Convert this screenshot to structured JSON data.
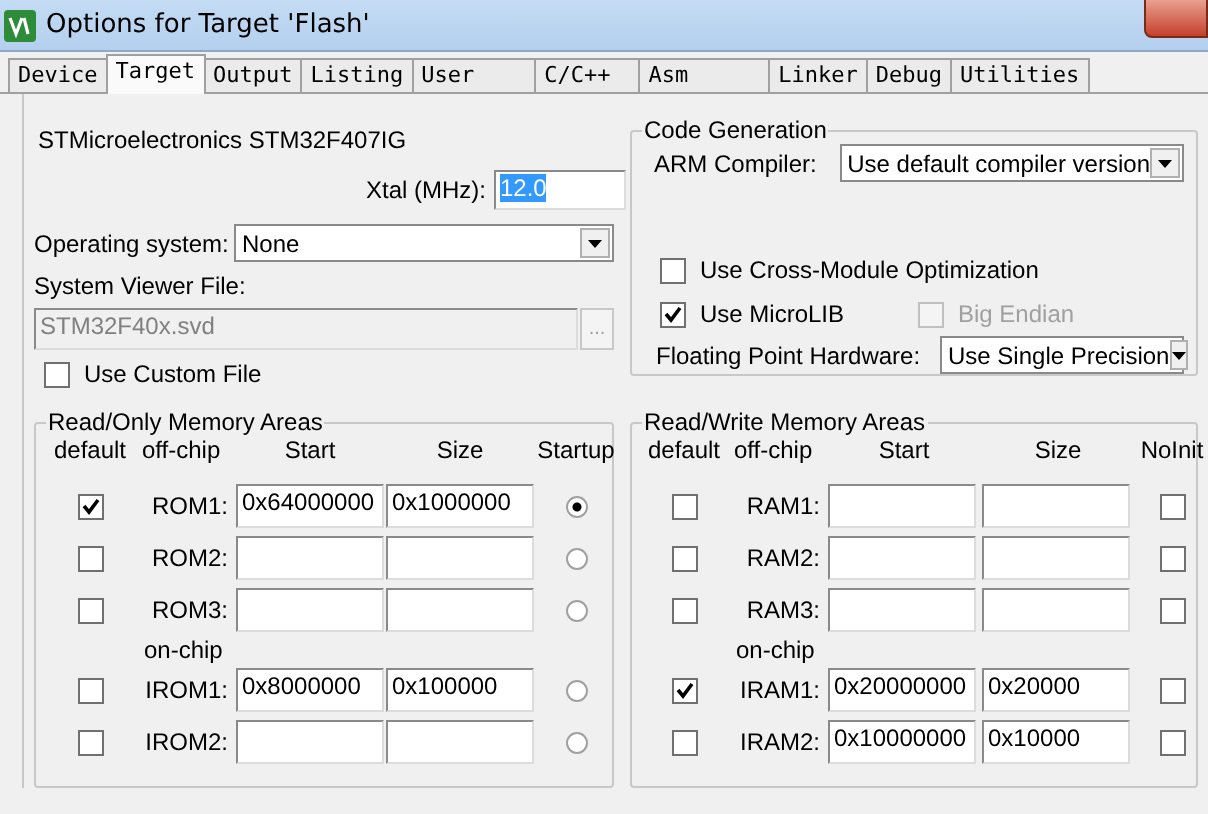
{
  "window": {
    "title": "Options for Target 'Flash'"
  },
  "tabs": [
    {
      "label": "Device",
      "selected": false
    },
    {
      "label": "Target",
      "selected": true
    },
    {
      "label": "Output",
      "selected": false
    },
    {
      "label": "Listing",
      "selected": false
    },
    {
      "label": "User",
      "selected": false
    },
    {
      "label": "C/C++",
      "selected": false
    },
    {
      "label": "Asm",
      "selected": false
    },
    {
      "label": "Linker",
      "selected": false
    },
    {
      "label": "Debug",
      "selected": false
    },
    {
      "label": "Utilities",
      "selected": false
    }
  ],
  "target": {
    "device": "STMicroelectronics STM32F407IG",
    "xtal": {
      "label": "Xtal (MHz):",
      "value": "12.0",
      "text_selected": true
    },
    "os": {
      "label": "Operating system:",
      "value": "None"
    },
    "svf": {
      "label": "System Viewer File:",
      "value": "STM32F40x.svd",
      "disabled": true,
      "browse": "..."
    },
    "custom_file": {
      "label": "Use Custom File",
      "checked": false
    }
  },
  "code_generation": {
    "title": "Code Generation",
    "compiler": {
      "label": "ARM Compiler:",
      "value": "Use default compiler version"
    },
    "cross_module": {
      "label": "Use Cross-Module Optimization",
      "checked": false,
      "disabled": false
    },
    "microlib": {
      "label": "Use MicroLIB",
      "checked": true,
      "disabled": false
    },
    "big_endian": {
      "label": "Big Endian",
      "checked": false,
      "disabled": true
    },
    "fpu": {
      "label": "Floating Point Hardware:",
      "value": "Use Single Precision"
    }
  },
  "memory_groups": [
    {
      "kind": "read-only",
      "title": "Read/Only Memory Areas",
      "columns": [
        "default",
        "off-chip",
        "Start",
        "Size",
        "Startup"
      ],
      "off_chip": [
        {
          "default": true,
          "name": "ROM1:",
          "start": "0x64000000",
          "size": "0x1000000",
          "startup": true
        },
        {
          "default": false,
          "name": "ROM2:",
          "startup": false
        },
        {
          "default": false,
          "name": "ROM3:",
          "startup": false
        }
      ],
      "on_chip_label": "on-chip",
      "on_chip": [
        {
          "default": false,
          "name": "IROM1:",
          "start": "0x8000000",
          "size": "0x100000",
          "startup": false
        },
        {
          "default": false,
          "name": "IROM2:",
          "startup": false
        }
      ]
    },
    {
      "kind": "read-write",
      "title": "Read/Write Memory Areas",
      "columns": [
        "default",
        "off-chip",
        "Start",
        "Size",
        "NoInit"
      ],
      "off_chip": [
        {
          "default": false,
          "name": "RAM1:",
          "noinit": false
        },
        {
          "default": false,
          "name": "RAM2:",
          "noinit": false
        },
        {
          "default": false,
          "name": "RAM3:",
          "noinit": false
        }
      ],
      "on_chip_label": "on-chip",
      "on_chip": [
        {
          "default": true,
          "name": "IRAM1:",
          "start": "0x20000000",
          "size": "0x20000",
          "noinit": false
        },
        {
          "default": false,
          "name": "IRAM2:",
          "start": "0x10000000",
          "size": "0x10000",
          "noinit": false
        }
      ]
    }
  ]
}
